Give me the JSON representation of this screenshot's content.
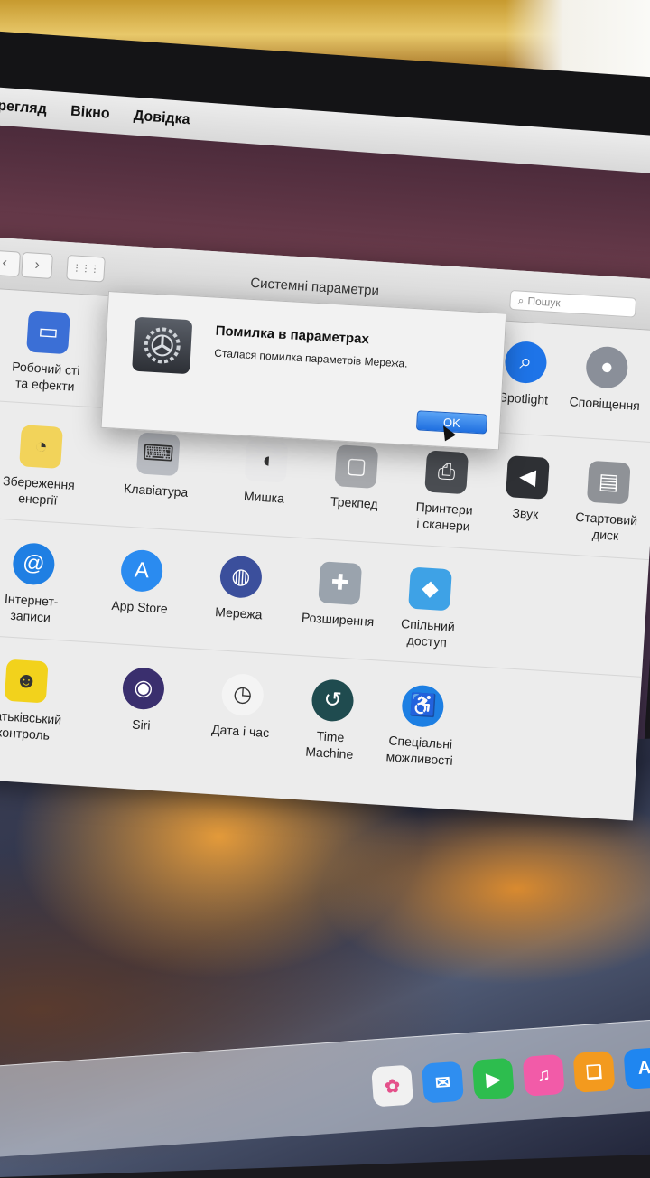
{
  "menubar": {
    "items": [
      "ерегляд",
      "Вікно",
      "Довідка"
    ]
  },
  "window": {
    "title": "Системні параметри",
    "search_placeholder": "Пошук",
    "nav_back": "‹",
    "nav_forward": "›",
    "grid_glyph": "⋮⋮⋮"
  },
  "alert": {
    "title": "Помилка в параметрах",
    "message": "Сталася помилка параметрів Мережа.",
    "ok_label": "OK"
  },
  "prefs": {
    "row1": [
      {
        "label": "Робочий сті\nта ефекти",
        "icon": "desktop-icon",
        "color": "#3b6fd6"
      },
      {
        "label": "Spotlight",
        "icon": "spotlight-icon",
        "color": "#1e74e8"
      },
      {
        "label": "Сповіщення",
        "icon": "notifications-icon",
        "color": "#8a8f99"
      }
    ],
    "row2": [
      {
        "label": "Збереження\nенергії",
        "icon": "bulb-icon",
        "color": "#f2d35a"
      },
      {
        "label": "Клавіатура",
        "icon": "keyboard-icon",
        "color": "#b9bcc2"
      },
      {
        "label": "Мишка",
        "icon": "mouse-icon",
        "color": "#e9e9ea"
      },
      {
        "label": "Трекпед",
        "icon": "trackpad-icon",
        "color": "#a7a9ad"
      },
      {
        "label": "Принтери\nі сканери",
        "icon": "printer-icon",
        "color": "#4a4d52"
      },
      {
        "label": "Звук",
        "icon": "speaker-icon",
        "color": "#2e3034"
      },
      {
        "label": "Стартовий\nдиск",
        "icon": "disk-icon",
        "color": "#8f9297"
      }
    ],
    "row3": [
      {
        "label": "Інтернет-\nзаписи",
        "icon": "at-icon",
        "color": "#1f7fe3"
      },
      {
        "label": "App Store",
        "icon": "appstore-icon",
        "color": "#2a8bf0"
      },
      {
        "label": "Мережа",
        "icon": "network-globe-icon",
        "color": "#3b4f9c"
      },
      {
        "label": "Розширення",
        "icon": "puzzle-icon",
        "color": "#9aa3ad"
      },
      {
        "label": "Спільний\nдоступ",
        "icon": "sharing-folder-icon",
        "color": "#3ea2e6"
      }
    ],
    "row4": [
      {
        "label": "Батьківський\nконтроль",
        "icon": "parental-control-icon",
        "color": "#f2d21c"
      },
      {
        "label": "Siri",
        "icon": "siri-icon",
        "color": "#3a2f6e"
      },
      {
        "label": "Дата і час",
        "icon": "clock-icon",
        "color": "#f4f4f4"
      },
      {
        "label": "Time\nMachine",
        "icon": "time-machine-icon",
        "color": "#1f4b4f"
      },
      {
        "label": "Спеціальні\nможливості",
        "icon": "accessibility-icon",
        "color": "#1d7fe3"
      }
    ]
  },
  "dock": [
    {
      "icon": "photos-icon",
      "color": "#f1f1f1"
    },
    {
      "icon": "messages-icon",
      "color": "#2f8ef0"
    },
    {
      "icon": "facetime-icon",
      "color": "#2dbd4e"
    },
    {
      "icon": "itunes-icon",
      "color": "#f25ba8"
    },
    {
      "icon": "ibooks-icon",
      "color": "#f39a1e"
    },
    {
      "icon": "appstore-dock-icon",
      "color": "#1f86f0"
    }
  ]
}
